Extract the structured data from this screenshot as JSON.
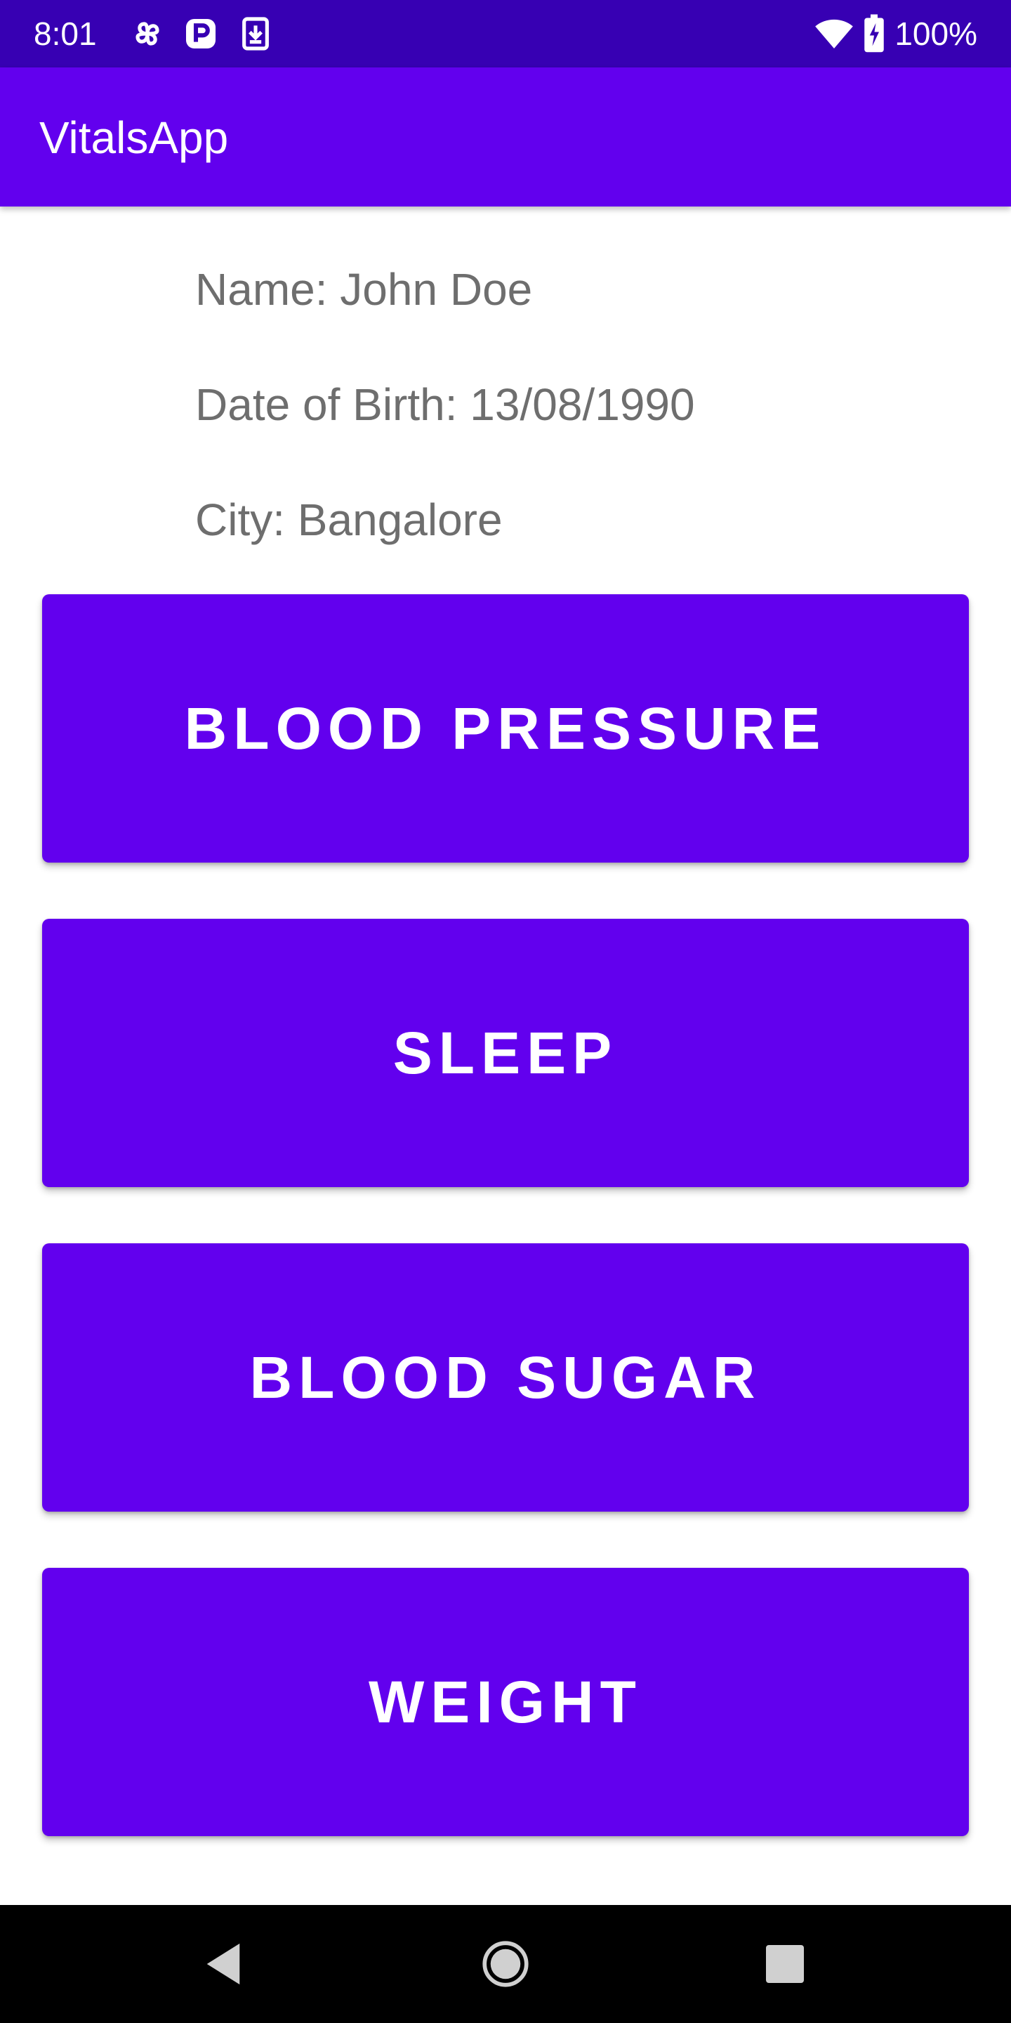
{
  "status_bar": {
    "time": "8:01",
    "battery": "100%",
    "icons": [
      "pinwheel-icon",
      "parking-p-icon",
      "download-icon",
      "wifi-icon",
      "battery-charging-icon"
    ]
  },
  "app_bar": {
    "title": "VitalsApp"
  },
  "profile": {
    "name": "Name: John Doe",
    "dob": "Date of Birth: 13/08/1990",
    "city": "City: Bangalore"
  },
  "buttons": [
    {
      "label": "BLOOD PRESSURE"
    },
    {
      "label": "SLEEP"
    },
    {
      "label": "BLOOD SUGAR"
    },
    {
      "label": "WEIGHT"
    }
  ],
  "nav_bar": {
    "icons": [
      "back-icon",
      "home-icon",
      "recents-icon"
    ]
  },
  "colors": {
    "status_bar": "#3700b3",
    "primary": "#6200ee",
    "text_secondary": "#6e6e6e"
  }
}
